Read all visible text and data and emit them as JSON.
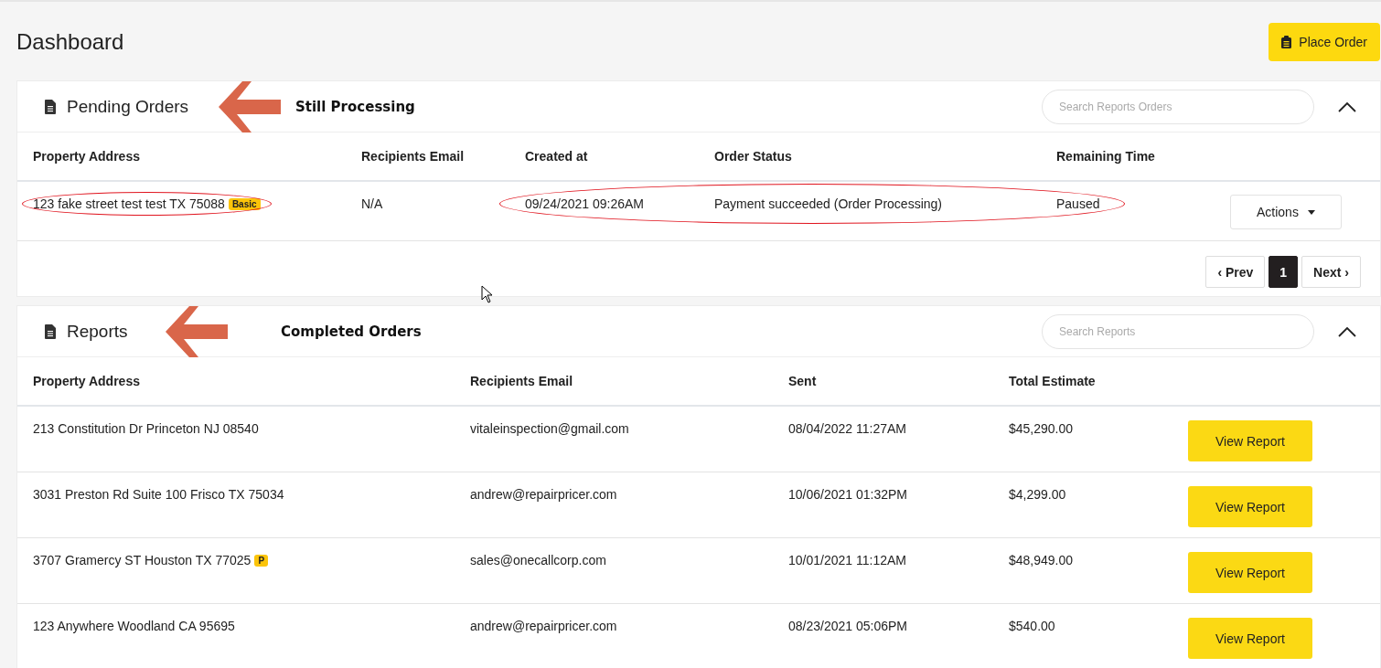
{
  "page": {
    "title": "Dashboard",
    "action": "Place Order"
  },
  "panels": [
    {
      "title": "Pending Orders",
      "annotation": "Still Processing",
      "search": {
        "placeholder": "Search Reports Orders"
      },
      "expanded": true,
      "columns": [
        "Property Address",
        "Recipients Email",
        "Created at",
        "Order Status",
        "Remaining Time"
      ],
      "rows": [
        {
          "cells": [
            {
              "text": "123 fake street test test TX 75088",
              "badge": "Basic",
              "circled": true
            },
            {
              "text": "N/A",
              "circled": false
            },
            {
              "text": "09/24/2021 09:26AM",
              "circled": true
            },
            {
              "text": "Payment succeeded (Order Processing)",
              "circled": true
            },
            {
              "text": "Paused",
              "circled": true
            }
          ],
          "action": {
            "kind": "dropdown",
            "label": "Actions"
          }
        }
      ],
      "pagination": {
        "prev": "‹ Prev",
        "pages": [
          {
            "label": "1",
            "selected": true
          }
        ],
        "next": "Next ›"
      }
    },
    {
      "title": "Reports",
      "annotation": "Completed Orders",
      "search": {
        "placeholder": "Search Reports"
      },
      "expanded": true,
      "columns": [
        "Property Address",
        "Recipients Email",
        "Sent",
        "Total Estimate"
      ],
      "rows": [
        {
          "cells": [
            {
              "text": "213 Constitution Dr Princeton NJ 08540",
              "circled": false
            },
            {
              "text": "vitaleinspection@gmail.com",
              "circled": false
            },
            {
              "text": "08/04/2022 11:27AM",
              "circled": false
            },
            {
              "text": "$45,290.00",
              "circled": false
            }
          ],
          "action": {
            "kind": "button",
            "label": "View Report"
          }
        },
        {
          "cells": [
            {
              "text": "3031 Preston Rd Suite 100 Frisco TX 75034",
              "circled": false
            },
            {
              "text": "andrew@repairpricer.com",
              "circled": false
            },
            {
              "text": "10/06/2021 01:32PM",
              "circled": false
            },
            {
              "text": "$4,299.00",
              "circled": false
            }
          ],
          "action": {
            "kind": "button",
            "label": "View Report"
          }
        },
        {
          "cells": [
            {
              "text": "3707 Gramercy ST Houston TX 77025",
              "badge": "P",
              "circled": false
            },
            {
              "text": "sales@onecallcorp.com",
              "circled": false
            },
            {
              "text": "10/01/2021 11:12AM",
              "circled": false
            },
            {
              "text": "$48,949.00",
              "circled": false
            }
          ],
          "action": {
            "kind": "button",
            "label": "View Report"
          }
        },
        {
          "cells": [
            {
              "text": "123 Anywhere Woodland CA 95695",
              "circled": false
            },
            {
              "text": "andrew@repairpricer.com",
              "circled": false
            },
            {
              "text": "08/23/2021 05:06PM",
              "circled": false
            },
            {
              "text": "$540.00",
              "circled": false
            }
          ],
          "action": {
            "kind": "button",
            "label": "View Report"
          }
        }
      ]
    }
  ]
}
